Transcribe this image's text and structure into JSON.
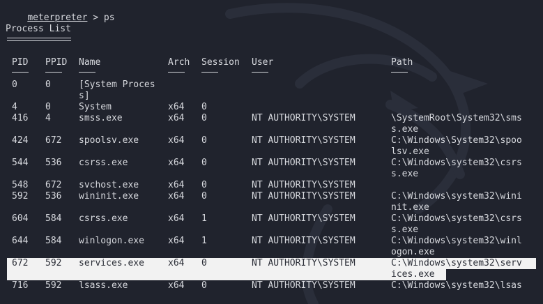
{
  "prompt": {
    "session": "meterpreter",
    "separator": " > ",
    "command": "ps"
  },
  "section_title": "Process List",
  "columns": [
    "PID",
    "PPID",
    "Name",
    "Arch",
    "Session",
    "User",
    "Path"
  ],
  "rows": [
    {
      "pid": "0",
      "ppid": "0",
      "name": "[System Proces\ns]",
      "arch": "",
      "session": "",
      "user": "",
      "path": ""
    },
    {
      "pid": "4",
      "ppid": "0",
      "name": "System",
      "arch": "x64",
      "session": "0",
      "user": "",
      "path": ""
    },
    {
      "pid": "416",
      "ppid": "4",
      "name": "smss.exe",
      "arch": "x64",
      "session": "0",
      "user": "NT AUTHORITY\\SYSTEM",
      "path": "\\SystemRoot\\System32\\sms\ns.exe"
    },
    {
      "pid": "424",
      "ppid": "672",
      "name": "spoolsv.exe",
      "arch": "x64",
      "session": "0",
      "user": "NT AUTHORITY\\SYSTEM",
      "path": "C:\\Windows\\System32\\spoo\nlsv.exe"
    },
    {
      "pid": "544",
      "ppid": "536",
      "name": "csrss.exe",
      "arch": "x64",
      "session": "0",
      "user": "NT AUTHORITY\\SYSTEM",
      "path": "C:\\Windows\\system32\\csrs\ns.exe"
    },
    {
      "pid": "548",
      "ppid": "672",
      "name": "svchost.exe",
      "arch": "x64",
      "session": "0",
      "user": "NT AUTHORITY\\SYSTEM",
      "path": ""
    },
    {
      "pid": "592",
      "ppid": "536",
      "name": "wininit.exe",
      "arch": "x64",
      "session": "0",
      "user": "NT AUTHORITY\\SYSTEM",
      "path": "C:\\Windows\\system32\\wini\nnit.exe"
    },
    {
      "pid": "604",
      "ppid": "584",
      "name": "csrss.exe",
      "arch": "x64",
      "session": "1",
      "user": "NT AUTHORITY\\SYSTEM",
      "path": "C:\\Windows\\system32\\csrs\ns.exe"
    },
    {
      "pid": "644",
      "ppid": "584",
      "name": "winlogon.exe",
      "arch": "x64",
      "session": "1",
      "user": "NT AUTHORITY\\SYSTEM",
      "path": "C:\\Windows\\system32\\winl\nogon.exe"
    },
    {
      "pid": "672",
      "ppid": "592",
      "name": "services.exe",
      "arch": "x64",
      "session": "0",
      "user": "NT AUTHORITY\\SYSTEM",
      "path": "C:\\Windows\\system32\\serv\nices.exe",
      "highlighted": true
    },
    {
      "pid": "716",
      "ppid": "592",
      "name": "lsass.exe",
      "arch": "x64",
      "session": "0",
      "user": "NT AUTHORITY\\SYSTEM",
      "path": "C:\\Windows\\system32\\lsas"
    }
  ]
}
